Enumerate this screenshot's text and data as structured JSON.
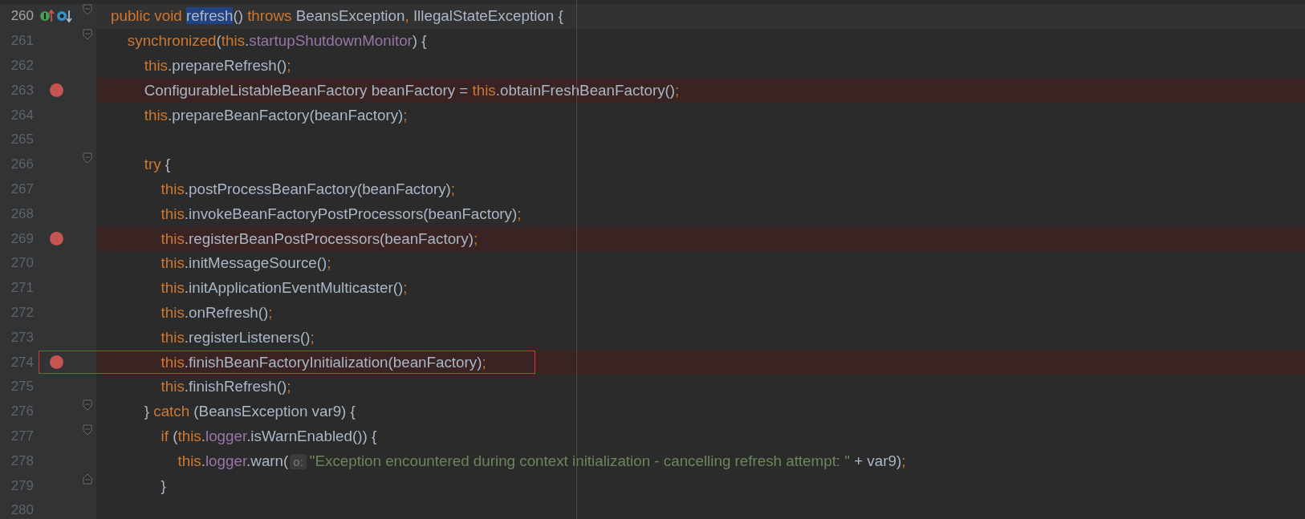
{
  "editor": {
    "lines": [
      {
        "number": "260",
        "current": true,
        "breakpoint": false,
        "boxed": false,
        "fold_start": true,
        "implements_marker": true,
        "overridden_marker": true,
        "tokens": [
          {
            "kind": "keyword",
            "text": "public void "
          },
          {
            "kind": "highlight",
            "text": "refresh"
          },
          {
            "kind": "plain",
            "text": "() "
          },
          {
            "kind": "keyword",
            "text": "throws "
          },
          {
            "kind": "plain",
            "text": "BeansException"
          },
          {
            "kind": "keyword",
            "text": ", "
          },
          {
            "kind": "plain",
            "text": "IllegalStateException {"
          }
        ]
      },
      {
        "number": "261",
        "current": false,
        "breakpoint": false,
        "boxed": false,
        "fold_start": true,
        "tokens": [
          {
            "kind": "keyword",
            "text": "    synchronized"
          },
          {
            "kind": "plain",
            "text": "("
          },
          {
            "kind": "keyword",
            "text": "this"
          },
          {
            "kind": "plain",
            "text": "."
          },
          {
            "kind": "field",
            "text": "startupShutdownMonitor"
          },
          {
            "kind": "plain",
            "text": ") {"
          }
        ]
      },
      {
        "number": "262",
        "current": false,
        "breakpoint": false,
        "boxed": false,
        "fold_start": false,
        "tokens": [
          {
            "kind": "keyword",
            "text": "        this"
          },
          {
            "kind": "plain",
            "text": ".prepareRefresh()"
          },
          {
            "kind": "keyword",
            "text": ";"
          }
        ]
      },
      {
        "number": "263",
        "current": false,
        "breakpoint": true,
        "boxed": false,
        "fold_start": false,
        "tokens": [
          {
            "kind": "plain",
            "text": "        ConfigurableListableBeanFactory beanFactory = "
          },
          {
            "kind": "keyword",
            "text": "this"
          },
          {
            "kind": "plain",
            "text": ".obtainFreshBeanFactory()"
          },
          {
            "kind": "keyword",
            "text": ";"
          }
        ]
      },
      {
        "number": "264",
        "current": false,
        "breakpoint": false,
        "boxed": false,
        "fold_start": false,
        "tokens": [
          {
            "kind": "keyword",
            "text": "        this"
          },
          {
            "kind": "plain",
            "text": ".prepareBeanFactory(beanFactory)"
          },
          {
            "kind": "keyword",
            "text": ";"
          }
        ]
      },
      {
        "number": "265",
        "current": false,
        "breakpoint": false,
        "boxed": false,
        "fold_start": false
      },
      {
        "number": "266",
        "current": false,
        "breakpoint": false,
        "boxed": false,
        "fold_start": true,
        "tokens": [
          {
            "kind": "keyword",
            "text": "        try "
          },
          {
            "kind": "plain",
            "text": "{"
          }
        ]
      },
      {
        "number": "267",
        "current": false,
        "breakpoint": false,
        "boxed": false,
        "fold_start": false,
        "tokens": [
          {
            "kind": "keyword",
            "text": "            this"
          },
          {
            "kind": "plain",
            "text": ".postProcessBeanFactory(beanFactory)"
          },
          {
            "kind": "keyword",
            "text": ";"
          }
        ]
      },
      {
        "number": "268",
        "current": false,
        "breakpoint": false,
        "boxed": false,
        "fold_start": false,
        "tokens": [
          {
            "kind": "keyword",
            "text": "            this"
          },
          {
            "kind": "plain",
            "text": ".invokeBeanFactoryPostProcessors(beanFactory)"
          },
          {
            "kind": "keyword",
            "text": ";"
          }
        ]
      },
      {
        "number": "269",
        "current": false,
        "breakpoint": true,
        "boxed": false,
        "fold_start": false,
        "tokens": [
          {
            "kind": "keyword",
            "text": "            this"
          },
          {
            "kind": "plain",
            "text": ".registerBeanPostProcessors(beanFactory)"
          },
          {
            "kind": "keyword",
            "text": ";"
          }
        ]
      },
      {
        "number": "270",
        "current": false,
        "breakpoint": false,
        "boxed": false,
        "fold_start": false,
        "tokens": [
          {
            "kind": "keyword",
            "text": "            this"
          },
          {
            "kind": "plain",
            "text": ".initMessageSource()"
          },
          {
            "kind": "keyword",
            "text": ";"
          }
        ]
      },
      {
        "number": "271",
        "current": false,
        "breakpoint": false,
        "boxed": false,
        "fold_start": false,
        "tokens": [
          {
            "kind": "keyword",
            "text": "            this"
          },
          {
            "kind": "plain",
            "text": ".initApplicationEventMulticaster()"
          },
          {
            "kind": "keyword",
            "text": ";"
          }
        ]
      },
      {
        "number": "272",
        "current": false,
        "breakpoint": false,
        "boxed": false,
        "fold_start": false,
        "tokens": [
          {
            "kind": "keyword",
            "text": "            this"
          },
          {
            "kind": "plain",
            "text": ".onRefresh()"
          },
          {
            "kind": "keyword",
            "text": ";"
          }
        ]
      },
      {
        "number": "273",
        "current": false,
        "breakpoint": false,
        "boxed": false,
        "fold_start": false,
        "tokens": [
          {
            "kind": "keyword",
            "text": "            this"
          },
          {
            "kind": "plain",
            "text": ".registerListeners()"
          },
          {
            "kind": "keyword",
            "text": ";"
          }
        ]
      },
      {
        "number": "274",
        "current": false,
        "breakpoint": true,
        "boxed": true,
        "fold_start": false,
        "tokens": [
          {
            "kind": "keyword",
            "text": "            this"
          },
          {
            "kind": "plain",
            "text": ".finishBeanFactoryInitialization(beanFactory)"
          },
          {
            "kind": "keyword",
            "text": ";"
          }
        ]
      },
      {
        "number": "275",
        "current": false,
        "breakpoint": false,
        "boxed": false,
        "fold_start": false,
        "tokens": [
          {
            "kind": "keyword",
            "text": "            this"
          },
          {
            "kind": "plain",
            "text": ".finishRefresh()"
          },
          {
            "kind": "keyword",
            "text": ";"
          }
        ]
      },
      {
        "number": "276",
        "current": false,
        "breakpoint": false,
        "boxed": false,
        "fold_start": true,
        "tokens": [
          {
            "kind": "plain",
            "text": "        } "
          },
          {
            "kind": "keyword",
            "text": "catch "
          },
          {
            "kind": "plain",
            "text": "(BeansException var9) {"
          }
        ]
      },
      {
        "number": "277",
        "current": false,
        "breakpoint": false,
        "boxed": false,
        "fold_start": true,
        "tokens": [
          {
            "kind": "keyword",
            "text": "            if "
          },
          {
            "kind": "plain",
            "text": "("
          },
          {
            "kind": "keyword",
            "text": "this"
          },
          {
            "kind": "plain",
            "text": "."
          },
          {
            "kind": "field",
            "text": "logger"
          },
          {
            "kind": "plain",
            "text": ".isWarnEnabled()) {"
          }
        ]
      },
      {
        "number": "278",
        "current": false,
        "breakpoint": false,
        "boxed": false,
        "fold_start": false,
        "tokens": [
          {
            "kind": "keyword",
            "text": "                this"
          },
          {
            "kind": "plain",
            "text": "."
          },
          {
            "kind": "field",
            "text": "logger"
          },
          {
            "kind": "plain",
            "text": ".warn("
          },
          {
            "kind": "hint",
            "text": "o:"
          },
          {
            "kind": "string",
            "text": "\"Exception encountered during context initialization - cancelling refresh attempt: \""
          },
          {
            "kind": "plain",
            "text": " + var9)"
          },
          {
            "kind": "keyword",
            "text": ";"
          }
        ]
      },
      {
        "number": "279",
        "current": false,
        "breakpoint": false,
        "boxed": false,
        "fold_start": false,
        "fold_end": true,
        "tokens": [
          {
            "kind": "plain",
            "text": "            }"
          }
        ]
      },
      {
        "number": "280",
        "current": false,
        "breakpoint": false,
        "boxed": false,
        "fold_start": false
      }
    ]
  }
}
